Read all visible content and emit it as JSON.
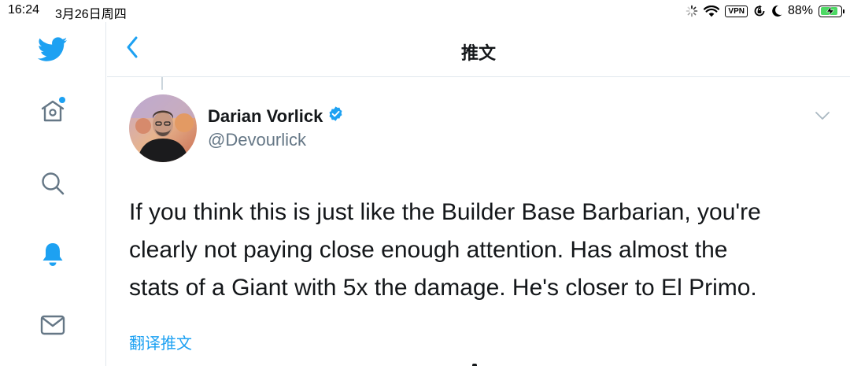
{
  "status_bar": {
    "time": "16:24",
    "date": "3月26日周四",
    "vpn_label": "VPN",
    "battery_percent_text": "88%",
    "battery_level": 0.88,
    "icons": [
      "activity-spinner-icon",
      "wifi-icon",
      "vpn-icon",
      "rotation-lock-icon",
      "do-not-disturb-moon-icon",
      "battery-charging-icon"
    ]
  },
  "sidebar": {
    "items": [
      {
        "icon": "twitter-bird-icon",
        "active": true
      },
      {
        "icon": "home-icon",
        "has_dot": true
      },
      {
        "icon": "search-icon"
      },
      {
        "icon": "notifications-bell-icon"
      },
      {
        "icon": "messages-envelope-icon"
      }
    ]
  },
  "header": {
    "back_icon": "chevron-left-icon",
    "title": "推文"
  },
  "tweet": {
    "author_name": "Darian Vorlick",
    "verified": true,
    "handle": "@Devourlick",
    "text_lines": [
      "If you think this is just like the Builder Base Barbarian, you're",
      "clearly not paying close enough attention.  Has almost the",
      "stats of a Giant with 5x the damage.  He's closer to El Primo."
    ],
    "translate_label": "翻译推文",
    "menu_icon": "chevron-down-icon"
  },
  "colors": {
    "accent": "#1da1f2",
    "text_primary": "#14171a",
    "text_secondary": "#657786",
    "divider": "#e1e8ed",
    "battery_fill": "#4cd964"
  }
}
